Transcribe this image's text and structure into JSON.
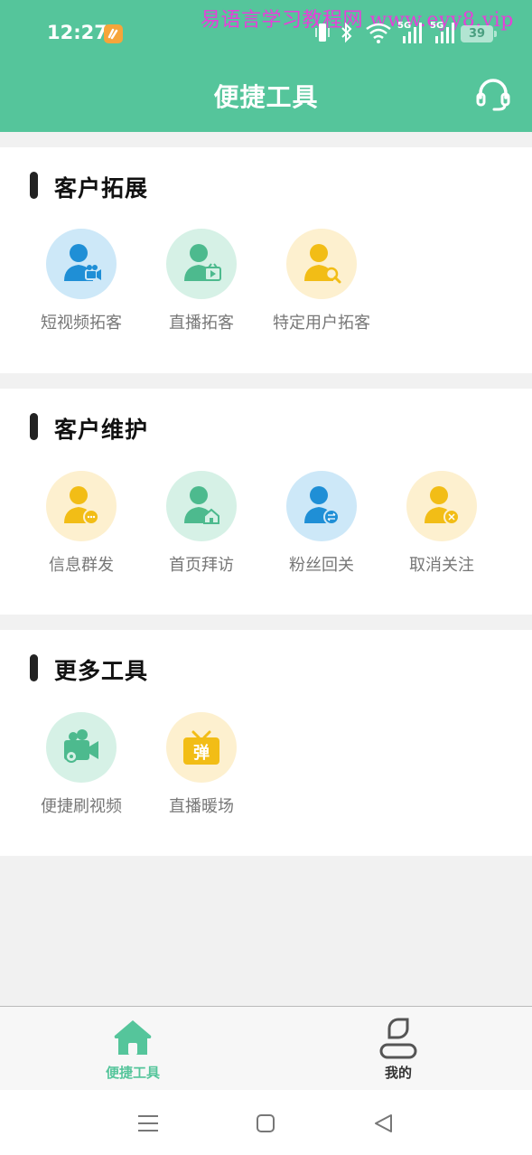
{
  "status_bar": {
    "time": "12:27",
    "watermark": "易语言学习教程网 www.eyy8.vip",
    "battery": "39",
    "network_labels": [
      "5G",
      "5G"
    ]
  },
  "header": {
    "title": "便捷工具",
    "support_icon": "headset-icon",
    "background_color": "#55c59b"
  },
  "sections": [
    {
      "title": "客户拓展",
      "tools": [
        {
          "label": "短视频拓客",
          "icon": "user-video-icon"
        },
        {
          "label": "直播拓客",
          "icon": "user-live-icon"
        },
        {
          "label": "特定用户拓客",
          "icon": "user-search-icon"
        }
      ]
    },
    {
      "title": "客户维护",
      "tools": [
        {
          "label": "信息群发",
          "icon": "user-message-icon"
        },
        {
          "label": "首页拜访",
          "icon": "user-home-icon"
        },
        {
          "label": "粉丝回关",
          "icon": "user-follow-back-icon"
        },
        {
          "label": "取消关注",
          "icon": "user-unfollow-icon"
        }
      ]
    },
    {
      "title": "更多工具",
      "tools": [
        {
          "label": "便捷刷视频",
          "icon": "video-camera-icon"
        },
        {
          "label": "直播暖场",
          "icon": "tv-danmaku-icon",
          "icon_text": "弹"
        }
      ]
    }
  ],
  "tabbar": {
    "tabs": [
      {
        "label": "便捷工具",
        "icon": "home-icon",
        "active": true
      },
      {
        "label": "我的",
        "icon": "profile-icon",
        "active": false
      }
    ],
    "active_color": "#55c59b"
  },
  "navbar": {
    "buttons": [
      "menu-icon",
      "home-square-icon",
      "back-triangle-icon"
    ]
  }
}
